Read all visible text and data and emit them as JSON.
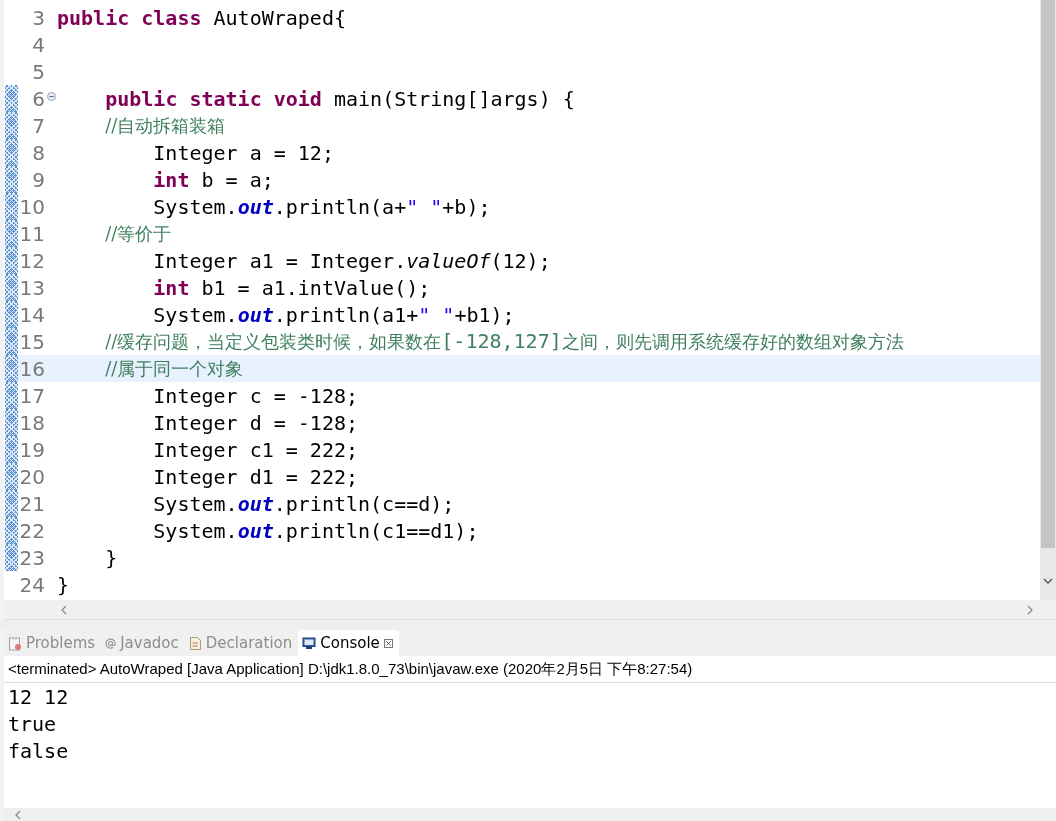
{
  "editor": {
    "lines": [
      {
        "number": "3",
        "tokens": [
          {
            "kind": "keyword",
            "t": "public class"
          },
          {
            "kind": "plain",
            "t": " AutoWraped{"
          }
        ],
        "current_line": false,
        "range_indicator": false,
        "fold_marker": false
      },
      {
        "number": "4",
        "current_line": false,
        "range_indicator": false,
        "fold_marker": false
      },
      {
        "number": "5",
        "current_line": false,
        "range_indicator": false,
        "fold_marker": false
      },
      {
        "number": "6",
        "tokens": [
          {
            "kind": "keyword",
            "t": "    public static void"
          },
          {
            "kind": "plain",
            "t": " main(String[]args) {"
          }
        ],
        "current_line": false,
        "range_indicator": true,
        "fold_marker": true
      },
      {
        "number": "7",
        "tokens": [
          {
            "kind": "comment",
            "t": "    //自动拆箱装箱"
          }
        ],
        "current_line": false,
        "range_indicator": true,
        "fold_marker": false
      },
      {
        "number": "8",
        "tokens": [
          {
            "kind": "plain",
            "t": "        Integer a = 12;"
          }
        ],
        "current_line": false,
        "range_indicator": true,
        "fold_marker": false
      },
      {
        "number": "9",
        "tokens": [
          {
            "kind": "keyword",
            "t": "        int"
          },
          {
            "kind": "plain",
            "t": " b = a;"
          }
        ],
        "current_line": false,
        "range_indicator": true,
        "fold_marker": false
      },
      {
        "number": "10",
        "tokens": [
          {
            "kind": "plain",
            "t": "        System."
          },
          {
            "kind": "field",
            "t": "out"
          },
          {
            "kind": "plain",
            "t": ".println(a+"
          },
          {
            "kind": "string",
            "t": "\" \""
          },
          {
            "kind": "plain",
            "t": "+b);"
          }
        ],
        "current_line": false,
        "range_indicator": true,
        "fold_marker": false
      },
      {
        "number": "11",
        "tokens": [
          {
            "kind": "comment",
            "t": "    //等价于"
          }
        ],
        "current_line": false,
        "range_indicator": true,
        "fold_marker": false
      },
      {
        "number": "12",
        "tokens": [
          {
            "kind": "plain",
            "t": "        Integer a1 = Integer."
          },
          {
            "kind": "static_method",
            "t": "valueOf"
          },
          {
            "kind": "plain",
            "t": "(12);"
          }
        ],
        "current_line": false,
        "range_indicator": true,
        "fold_marker": false
      },
      {
        "number": "13",
        "tokens": [
          {
            "kind": "keyword",
            "t": "        int"
          },
          {
            "kind": "plain",
            "t": " b1 = a1.intValue();"
          }
        ],
        "current_line": false,
        "range_indicator": true,
        "fold_marker": false
      },
      {
        "number": "14",
        "tokens": [
          {
            "kind": "plain",
            "t": "        System."
          },
          {
            "kind": "field",
            "t": "out"
          },
          {
            "kind": "plain",
            "t": ".println(a1+"
          },
          {
            "kind": "string",
            "t": "\" \""
          },
          {
            "kind": "plain",
            "t": "+b1);"
          }
        ],
        "current_line": false,
        "range_indicator": true,
        "fold_marker": false
      },
      {
        "number": "15",
        "tokens": [
          {
            "kind": "comment",
            "t": "    //缓存问题，当定义包装类时候，如果数在"
          },
          {
            "kind": "comment_mono",
            "t": "[-128,127]"
          },
          {
            "kind": "comment",
            "t": "之间，则先调用系统缓存好的数组对象方法"
          }
        ],
        "current_line": false,
        "range_indicator": true,
        "fold_marker": false
      },
      {
        "number": "16",
        "tokens": [
          {
            "kind": "comment",
            "t": "    //属于同一个对象"
          }
        ],
        "current_line": true,
        "range_indicator": true,
        "fold_marker": false
      },
      {
        "number": "17",
        "tokens": [
          {
            "kind": "plain",
            "t": "        Integer c = -128;"
          }
        ],
        "current_line": false,
        "range_indicator": true,
        "fold_marker": false
      },
      {
        "number": "18",
        "tokens": [
          {
            "kind": "plain",
            "t": "        Integer d = -128;"
          }
        ],
        "current_line": false,
        "range_indicator": true,
        "fold_marker": false
      },
      {
        "number": "19",
        "tokens": [
          {
            "kind": "plain",
            "t": "        Integer c1 = 222;"
          }
        ],
        "current_line": false,
        "range_indicator": true,
        "fold_marker": false
      },
      {
        "number": "20",
        "tokens": [
          {
            "kind": "plain",
            "t": "        Integer d1 = 222;"
          }
        ],
        "current_line": false,
        "range_indicator": true,
        "fold_marker": false
      },
      {
        "number": "21",
        "tokens": [
          {
            "kind": "plain",
            "t": "        System."
          },
          {
            "kind": "field",
            "t": "out"
          },
          {
            "kind": "plain",
            "t": ".println(c==d);"
          }
        ],
        "current_line": false,
        "range_indicator": true,
        "fold_marker": false
      },
      {
        "number": "22",
        "tokens": [
          {
            "kind": "plain",
            "t": "        System."
          },
          {
            "kind": "field",
            "t": "out"
          },
          {
            "kind": "plain",
            "t": ".println(c1==d1);"
          }
        ],
        "current_line": false,
        "range_indicator": true,
        "fold_marker": false
      },
      {
        "number": "23",
        "tokens": [
          {
            "kind": "plain",
            "t": "    }"
          }
        ],
        "current_line": false,
        "range_indicator": true,
        "fold_marker": false
      },
      {
        "number": "24",
        "tokens": [
          {
            "kind": "plain",
            "t": "}"
          }
        ],
        "current_line": false,
        "range_indicator": false,
        "fold_marker": false
      }
    ]
  },
  "panel": {
    "tabs": [
      {
        "kind": "problems",
        "label": "Problems",
        "selected": false
      },
      {
        "kind": "javadoc",
        "label": "Javadoc",
        "selected": false
      },
      {
        "kind": "declaration",
        "label": "Declaration",
        "selected": false
      },
      {
        "kind": "console",
        "label": "Console",
        "selected": true
      }
    ],
    "console_header": "<terminated> AutoWraped [Java Application] D:\\jdk1.8.0_73\\bin\\javaw.exe (2020年2月5日 下午8:27:54)",
    "output": [
      "12 12",
      "true",
      "false"
    ]
  }
}
